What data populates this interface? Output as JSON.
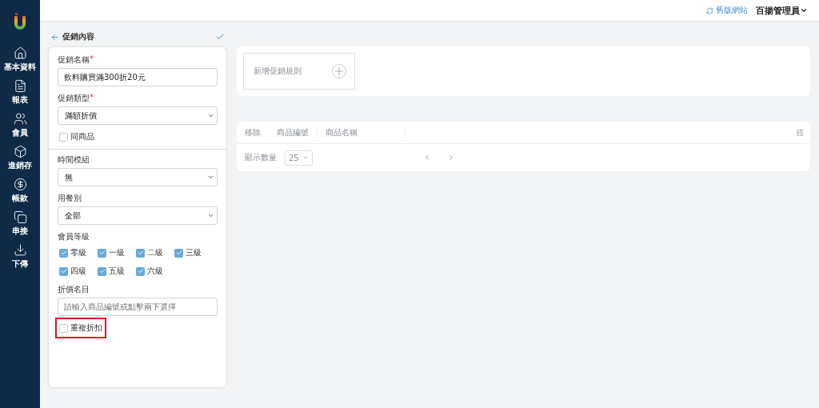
{
  "sidebar": {
    "items": [
      {
        "label": "基本資料"
      },
      {
        "label": "報表"
      },
      {
        "label": "會員"
      },
      {
        "label": "進銷存"
      },
      {
        "label": "帳款"
      },
      {
        "label": "串接"
      },
      {
        "label": "下傳"
      }
    ]
  },
  "topbar": {
    "link": "舊版網站",
    "user": "百揚管理員"
  },
  "form": {
    "title": "促銷內容",
    "name": {
      "label": "促銷名稱",
      "required_mark": "*",
      "value": "飲料購買滿300折20元"
    },
    "type": {
      "label": "促銷類型",
      "required_mark": "*",
      "value": "滿額折價"
    },
    "same_product": {
      "label": "同商品",
      "checked": false
    },
    "time_module": {
      "label": "時間模組",
      "value": "無"
    },
    "meal": {
      "label": "用餐別",
      "value": "全部"
    },
    "levels": {
      "label": "會員等級",
      "items": [
        {
          "label": "零級",
          "checked": true
        },
        {
          "label": "一級",
          "checked": true
        },
        {
          "label": "二級",
          "checked": true
        },
        {
          "label": "三級",
          "checked": true
        },
        {
          "label": "四級",
          "checked": true
        },
        {
          "label": "五級",
          "checked": true
        },
        {
          "label": "六級",
          "checked": true
        }
      ]
    },
    "discount_item": {
      "label": "折價名目",
      "placeholder": "請輸入商品編號或點擊兩下選擇"
    },
    "repeat": {
      "label": "重複折扣",
      "checked": false,
      "highlighted": true
    }
  },
  "rules": {
    "disabled": true,
    "add_label": "新增促銷規則"
  },
  "table": {
    "disabled": true,
    "columns": [
      "移除",
      "商品編號",
      "商品名稱"
    ],
    "page_size_label": "顯示數量",
    "page_size": "25"
  }
}
